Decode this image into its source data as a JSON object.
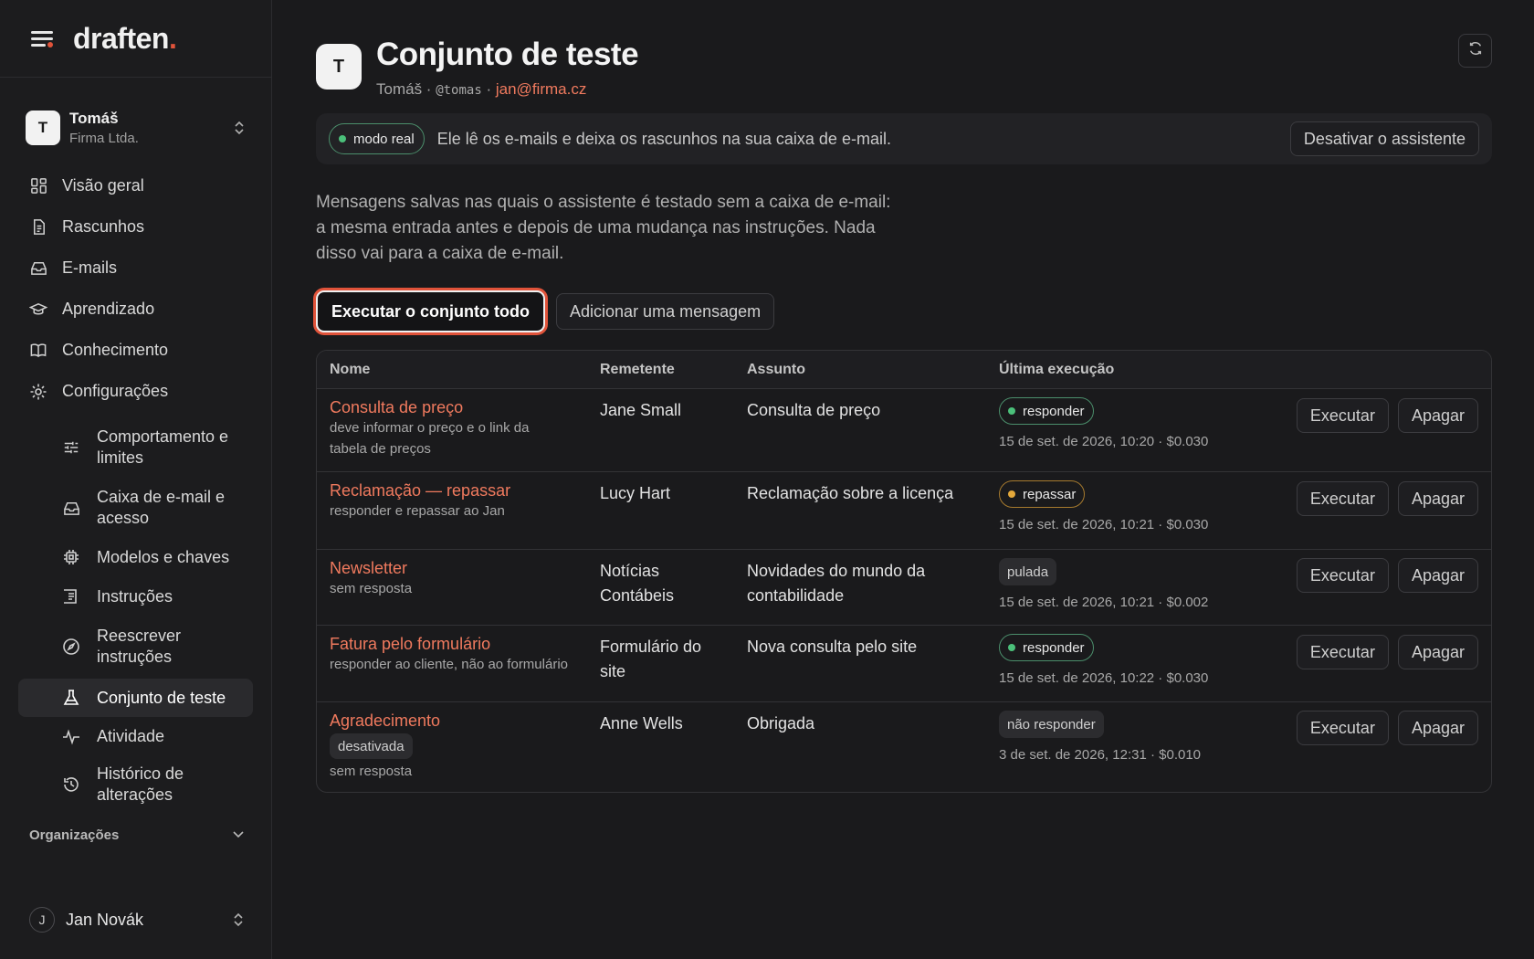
{
  "brand": {
    "name": "draften",
    "dot": "."
  },
  "account": {
    "initial": "T",
    "name": "Tomáš",
    "company": "Firma Ltda."
  },
  "nav": {
    "overview": "Visão geral",
    "drafts": "Rascunhos",
    "emails": "E-mails",
    "learning": "Aprendizado",
    "knowledge": "Conhecimento",
    "settings": "Configurações"
  },
  "settings_items": {
    "behavior": "Comportamento e limites",
    "mailbox": "Caixa de e-mail e acesso",
    "models": "Modelos e chaves",
    "instructions": "Instruções",
    "rewrite": "Reescrever instruções",
    "test_set": "Conjunto de teste",
    "activity": "Atividade",
    "history": "Histórico de alterações"
  },
  "organizations_label": "Organizações",
  "user": {
    "initial": "J",
    "name": "Jan Novák"
  },
  "page": {
    "avatar_initial": "T",
    "title": "Conjunto de teste",
    "owner": "Tomáš",
    "sep1": " · ",
    "handle": "@tomas",
    "sep2": " · ",
    "email": "jan@firma.cz"
  },
  "banner": {
    "mode": "modo real",
    "text": "Ele lê os e-mails e deixa os rascunhos na sua caixa de e-mail.",
    "disable_button": "Desativar o assistente"
  },
  "intro": "Mensagens salvas nas quais o assistente é testado sem a caixa de e-mail: a mesma entrada antes e depois de uma mudança nas instruções. Nada disso vai para a caixa de e-mail.",
  "actions": {
    "run_all": "Executar o conjunto todo",
    "add_message": "Adicionar uma mensagem"
  },
  "table": {
    "headers": {
      "name": "Nome",
      "sender": "Remetente",
      "subject": "Assunto",
      "last_run": "Última execução"
    },
    "run_label": "Executar",
    "delete_label": "Apagar",
    "rows": [
      {
        "name": "Consulta de preço",
        "desc": "deve informar o preço e o link da tabela de preços",
        "sender": "Jane Small",
        "subject": "Consulta de preço",
        "result": "responder",
        "result_style": "green",
        "last": "15 de set. de 2026, 10:20 · $0.030"
      },
      {
        "name": "Reclamação — repassar",
        "desc": "responder e repassar ao Jan",
        "sender": "Lucy Hart",
        "subject": "Reclamação sobre a licença",
        "result": "repassar",
        "result_style": "amber",
        "last": "15 de set. de 2026, 10:21 · $0.030"
      },
      {
        "name": "Newsletter",
        "desc": "sem resposta",
        "sender": "Notícias Contábeis",
        "subject": "Novidades do mundo da contabilidade",
        "result": "pulada",
        "result_style": "gray",
        "last": "15 de set. de 2026, 10:21 · $0.002"
      },
      {
        "name": "Fatura pelo formulário",
        "desc": "responder ao cliente, não ao formulário",
        "sender": "Formulário do site",
        "subject": "Nova consulta pelo site",
        "result": "responder",
        "result_style": "green",
        "last": "15 de set. de 2026, 10:22 · $0.030"
      },
      {
        "name": "Agradecimento",
        "inactive": "desativada",
        "desc": "sem resposta",
        "sender": "Anne Wells",
        "subject": "Obrigada",
        "result": "não responder",
        "result_style": "gray",
        "last": "3 de set. de 2026, 12:31 · $0.010"
      }
    ]
  },
  "colors": {
    "accent": "#e0533a",
    "link": "#f07a5e",
    "background": "#1a1a1c",
    "status_green": "#4bc07a",
    "status_amber": "#e5a93b"
  },
  "icons": {
    "overview": "grid-icon",
    "drafts": "document-icon",
    "emails": "inbox-icon",
    "learning": "graduation-cap-icon",
    "knowledge": "book-icon",
    "settings": "gear-icon",
    "behavior": "sliders-icon",
    "mailbox": "inbox-icon",
    "models": "chip-icon",
    "instructions": "list-icon",
    "rewrite": "compass-icon",
    "test_set": "flask-icon",
    "activity": "activity-icon",
    "history": "history-icon",
    "refresh": "refresh-icon"
  }
}
